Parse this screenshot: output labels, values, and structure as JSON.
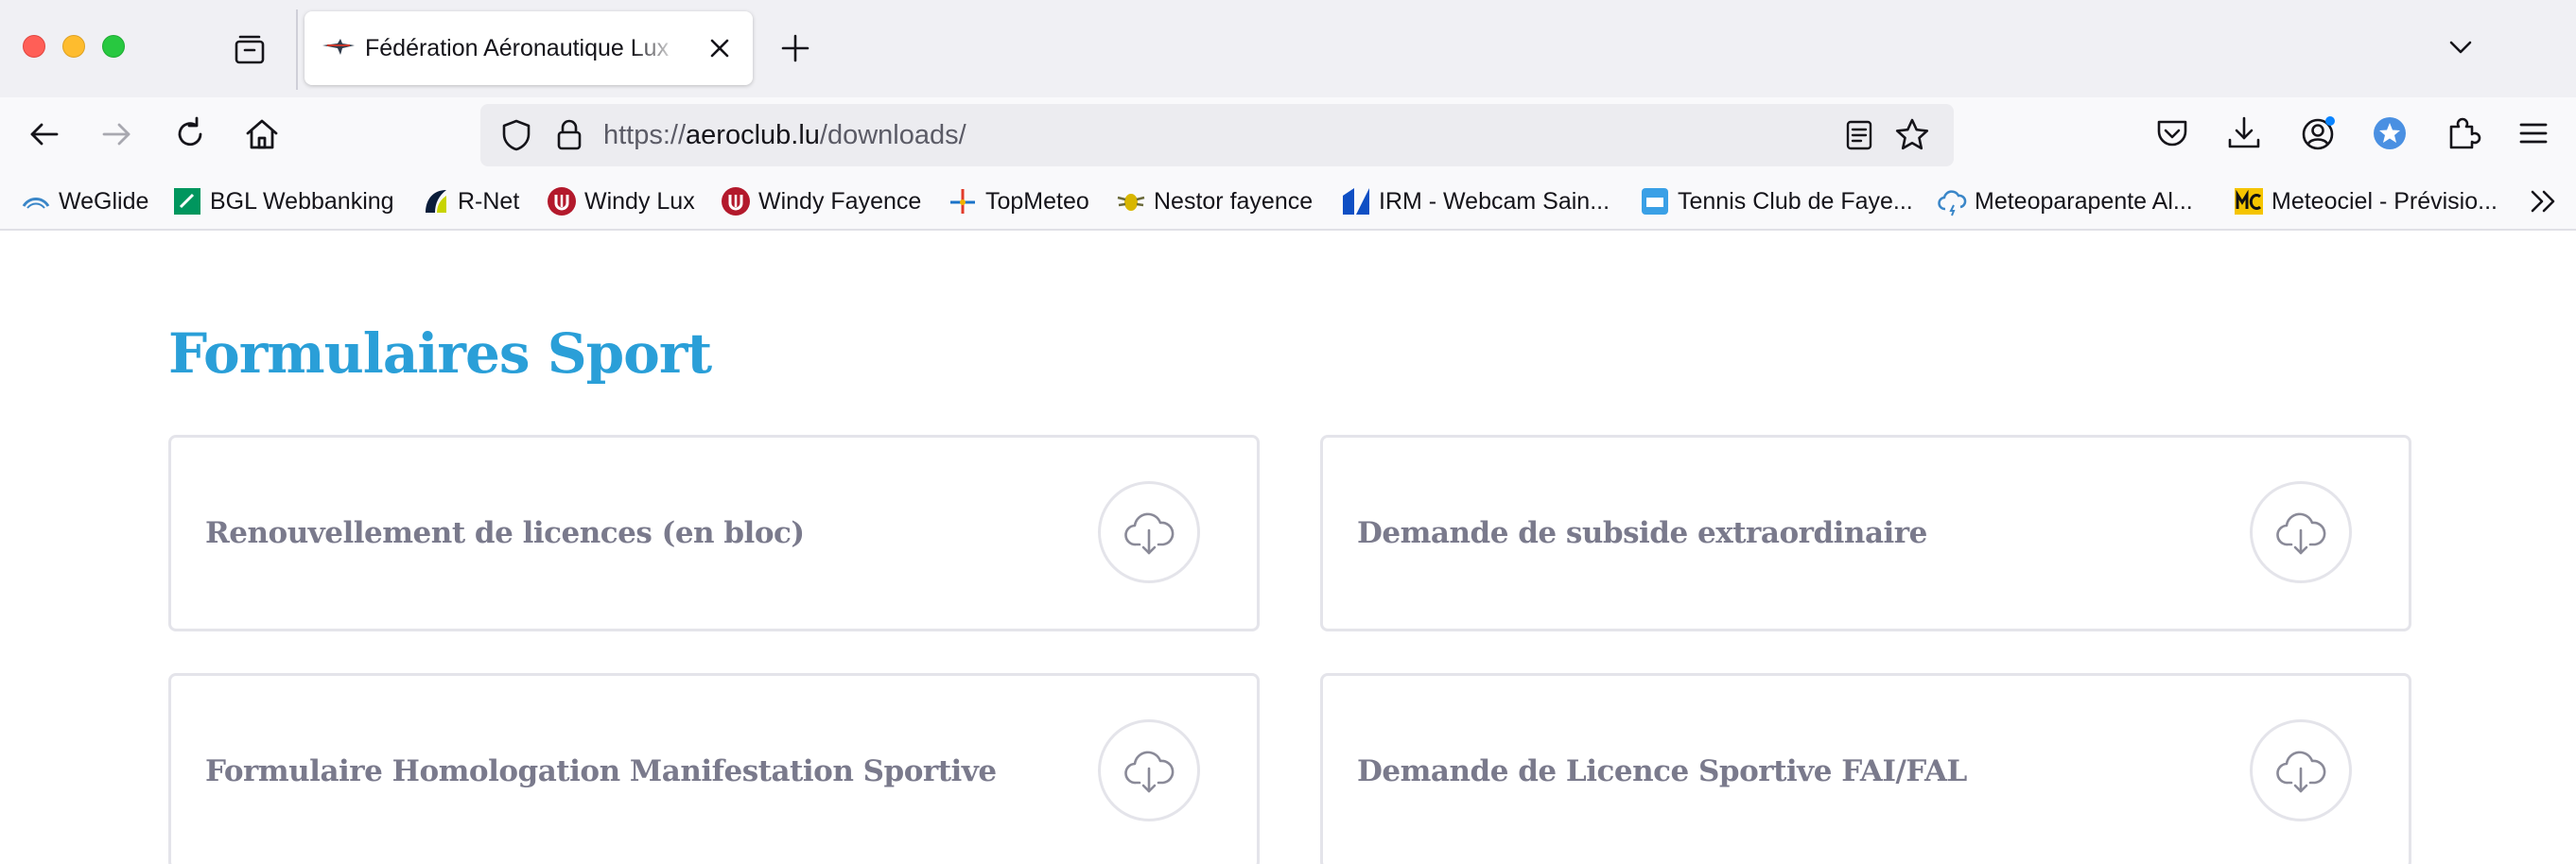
{
  "browser": {
    "tab": {
      "title": "Fédération Aéronautique Luxembourgeoise"
    },
    "url": {
      "scheme": "https://",
      "host": "aeroclub.lu",
      "path": "/downloads/"
    },
    "bookmarks": [
      {
        "label": "WeGlide",
        "icon": "weglide-icon"
      },
      {
        "label": "BGL Webbanking",
        "icon": "bgl-icon"
      },
      {
        "label": "R-Net",
        "icon": "rnet-icon"
      },
      {
        "label": "Windy Lux",
        "icon": "windy-icon"
      },
      {
        "label": "Windy Fayence",
        "icon": "windy-icon"
      },
      {
        "label": "TopMeteo",
        "icon": "topmeteo-icon"
      },
      {
        "label": "Nestor fayence",
        "icon": "nestor-icon"
      },
      {
        "label": "IRM - Webcam Sain...",
        "icon": "irm-icon"
      },
      {
        "label": "Tennis Club de Faye...",
        "icon": "tennis-icon"
      },
      {
        "label": "Meteoparapente Al...",
        "icon": "cloud-icon"
      },
      {
        "label": "Meteociel - Prévisio...",
        "icon": "meteociel-icon"
      }
    ],
    "colors": {
      "tabstrip": "#f0f0f4",
      "toolbar": "#f9f9fb",
      "urlbar": "#ececf0"
    }
  },
  "page": {
    "title": "Formulaires Sport",
    "title_color": "#2a9fd8",
    "downloads": [
      {
        "label": "Renouvellement de licences (en bloc)"
      },
      {
        "label": "Demande de subside extraordinaire"
      },
      {
        "label": "Formulaire Homologation Manifestation Sportive"
      },
      {
        "label": "Demande de Licence Sportive FAI/FAL"
      }
    ]
  }
}
